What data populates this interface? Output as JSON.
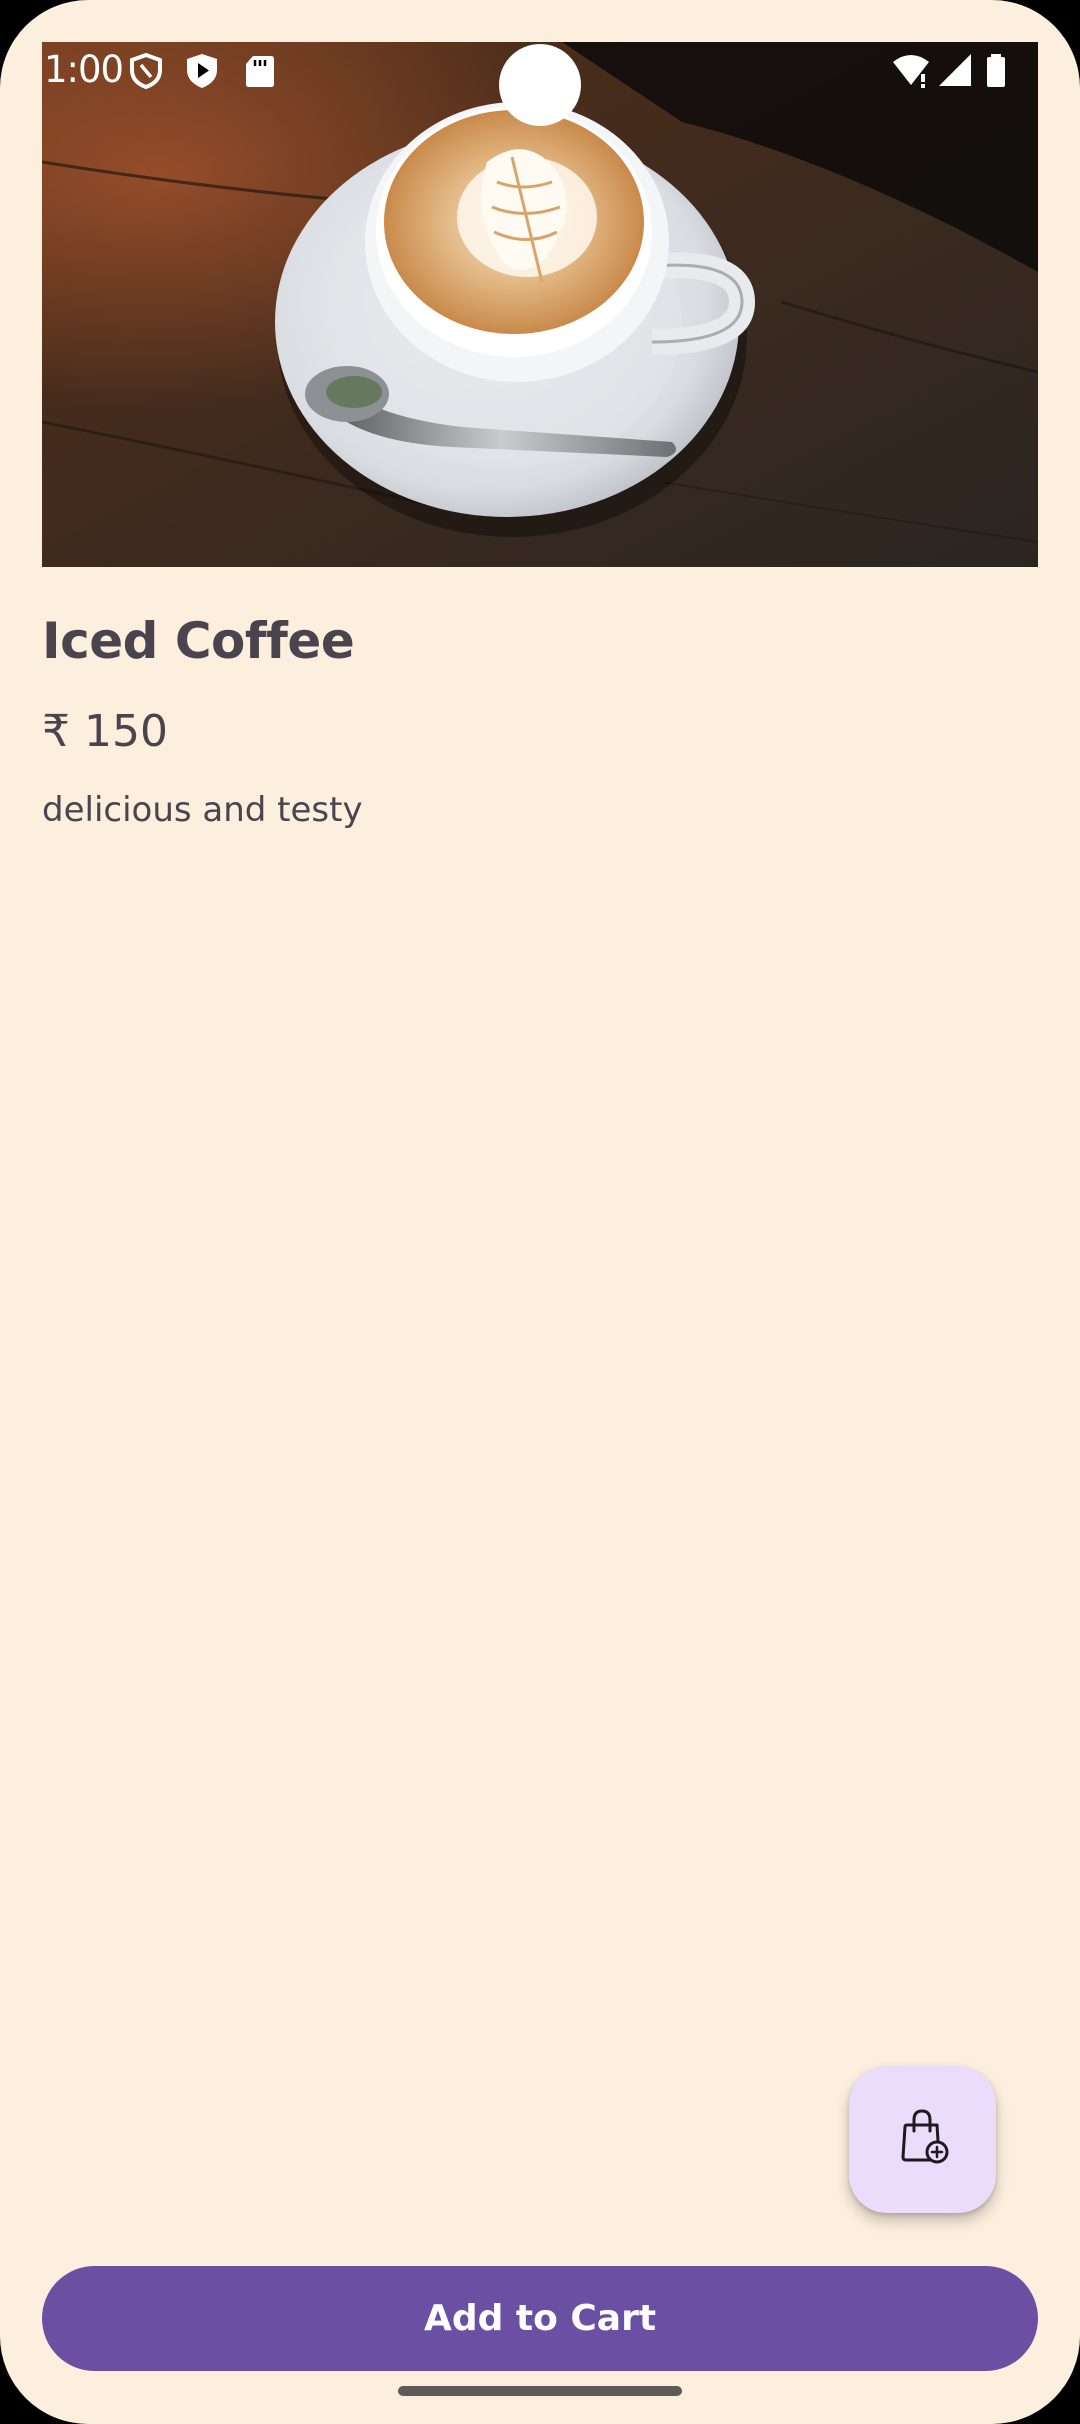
{
  "status_bar": {
    "time": "1:00",
    "left_icons": [
      "shield-outline-icon",
      "play-shield-icon",
      "sd-card-icon"
    ],
    "right_icons": [
      "wifi-icon",
      "signal-icon",
      "battery-icon"
    ]
  },
  "product": {
    "image": "latte-art-coffee-cup-photo",
    "name": "Iced Coffee",
    "price": "₹ 150",
    "description": "delicious and testy"
  },
  "fab": {
    "icon": "shopping-bag-add-icon"
  },
  "actions": {
    "add_to_cart_label": "Add to Cart"
  },
  "colors": {
    "background": "#FDEFDE",
    "primary": "#6A4FA3",
    "fab_bg": "#EBDCFB",
    "text": "#4A444E"
  }
}
